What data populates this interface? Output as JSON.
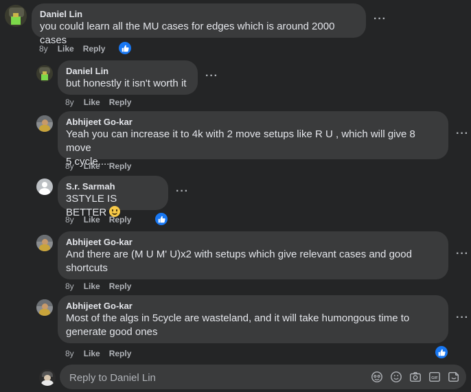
{
  "comments": [
    {
      "author": "Daniel Lin",
      "lines": [
        "you could learn all the MU cases for edges which is around 2000 cases"
      ],
      "age": "8y",
      "like": "Like",
      "reply": "Reply",
      "reaction": "like"
    },
    {
      "author": "Daniel Lin",
      "lines": [
        "but honestly it isn't worth it"
      ],
      "age": "8y",
      "like": "Like",
      "reply": "Reply"
    },
    {
      "author": "Abhijeet Go-kar",
      "lines": [
        "Yeah you can increase it to 4k with 2 move setups like R U , which will give 8 move",
        "5 cycle...."
      ],
      "age": "8y",
      "like": "Like",
      "reply": "Reply"
    },
    {
      "author": "S.r. Sarmah",
      "lines": [
        "3STYLE IS BETTER"
      ],
      "emoji": "smiling-face",
      "age": "8y",
      "like": "Like",
      "reply": "Reply",
      "reaction": "like"
    },
    {
      "author": "Abhijeet Go-kar",
      "lines": [
        "And there are (M U M' U)x2 with setups which give relevant cases and good",
        "shortcuts"
      ],
      "age": "8y",
      "like": "Like",
      "reply": "Reply"
    },
    {
      "author": "Abhijeet Go-kar",
      "lines": [
        "Most of the algs in 5cycle are wasteland, and it will take humongous time to",
        "generate good ones"
      ],
      "age": "8y",
      "like": "Like",
      "reply": "Reply",
      "reaction": "like"
    }
  ],
  "reply_box": {
    "placeholder": "Reply to Daniel Lin",
    "tools": [
      "avatar-sticker-icon",
      "emoji-icon",
      "camera-icon",
      "gif-icon",
      "sticker-icon"
    ]
  },
  "colors": {
    "background": "#242526",
    "bubble": "#3a3b3c",
    "like_blue": "#1877f2",
    "muted": "#b0b3b8"
  }
}
